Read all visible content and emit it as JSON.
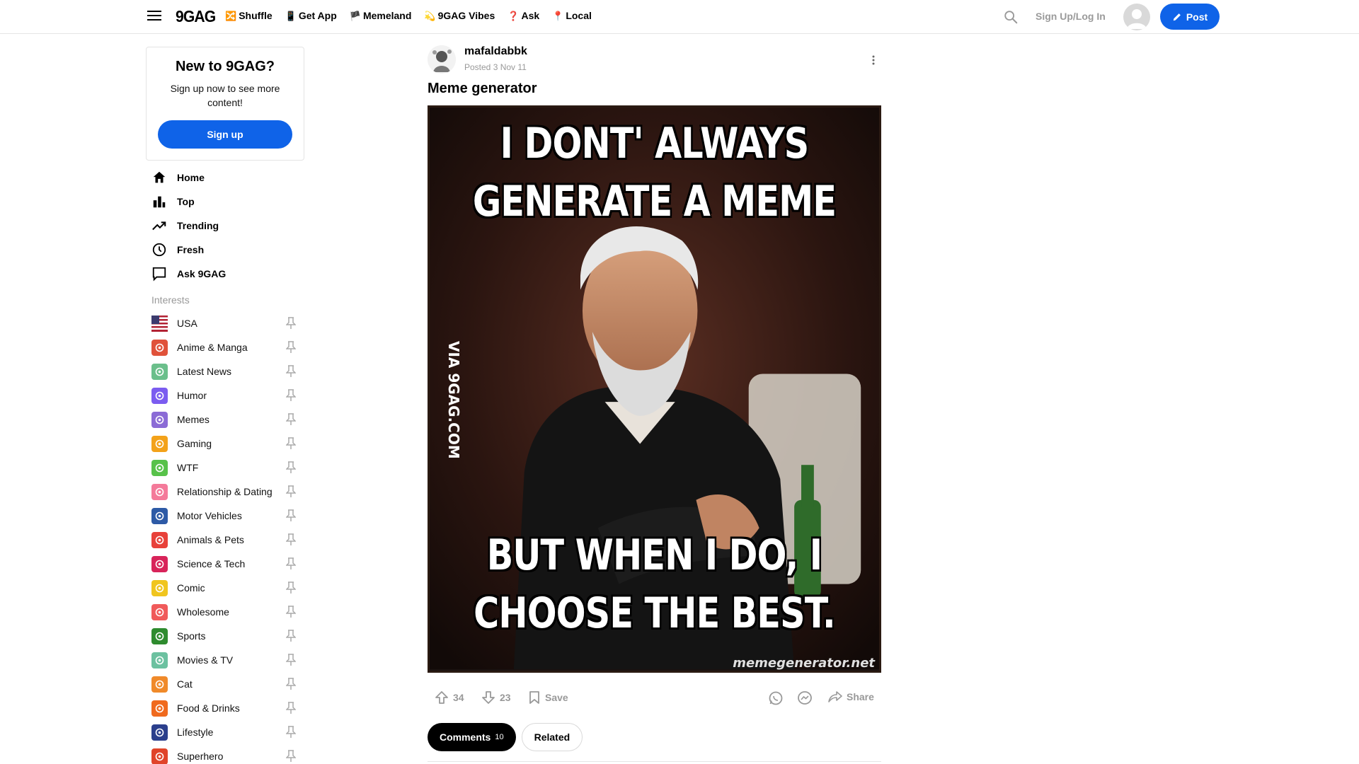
{
  "header": {
    "logo": "9GAG",
    "nav": [
      {
        "emoji": "🔀",
        "label": "Shuffle"
      },
      {
        "emoji": "📱",
        "label": "Get App"
      },
      {
        "emoji": "🏴",
        "label": "Memeland"
      },
      {
        "emoji": "💫",
        "label": "9GAG Vibes"
      },
      {
        "emoji": "❓",
        "label": "Ask"
      },
      {
        "emoji": "📍",
        "label": "Local"
      }
    ],
    "signup_login": "Sign Up/Log In",
    "post_label": "Post",
    "accent": "#0f63e8"
  },
  "sidebar": {
    "card": {
      "title": "New to 9GAG?",
      "text": "Sign up now to see more content!",
      "button": "Sign up"
    },
    "nav": [
      {
        "label": "Home",
        "icon": "home-icon"
      },
      {
        "label": "Top",
        "icon": "bar-chart-icon"
      },
      {
        "label": "Trending",
        "icon": "trending-icon"
      },
      {
        "label": "Fresh",
        "icon": "clock-icon"
      },
      {
        "label": "Ask 9GAG",
        "icon": "chat-icon"
      }
    ],
    "interests_title": "Interests",
    "interests": [
      {
        "label": "USA",
        "color": "#b22234"
      },
      {
        "label": "Anime & Manga",
        "color": "#e0523a"
      },
      {
        "label": "Latest News",
        "color": "#6bbf8b"
      },
      {
        "label": "Humor",
        "color": "#7b5cf0"
      },
      {
        "label": "Memes",
        "color": "#8b6bd6"
      },
      {
        "label": "Gaming",
        "color": "#f3a21a"
      },
      {
        "label": "WTF",
        "color": "#58c24a"
      },
      {
        "label": "Relationship & Dating",
        "color": "#f47a9a"
      },
      {
        "label": "Motor Vehicles",
        "color": "#2d5aa6"
      },
      {
        "label": "Animals & Pets",
        "color": "#e8413a"
      },
      {
        "label": "Science & Tech",
        "color": "#d8245a"
      },
      {
        "label": "Comic",
        "color": "#f0c51e"
      },
      {
        "label": "Wholesome",
        "color": "#f05a5a"
      },
      {
        "label": "Sports",
        "color": "#2e8b2e"
      },
      {
        "label": "Movies & TV",
        "color": "#6cc1a0"
      },
      {
        "label": "Cat",
        "color": "#f08a2a"
      },
      {
        "label": "Food & Drinks",
        "color": "#f06a1e"
      },
      {
        "label": "Lifestyle",
        "color": "#2b3f8c"
      },
      {
        "label": "Superhero",
        "color": "#e0442a"
      }
    ]
  },
  "post": {
    "author": "mafaldabbk",
    "posted": "Posted 3 Nov 11",
    "title": "Meme generator",
    "meme_top": "I DONT' ALWAYS GENERATE A MEME",
    "meme_bottom": "BUT WHEN I DO, I CHOOSE THE BEST.",
    "watermark_side": "VIA 9GAG.COM",
    "watermark_bottom": "memegenerator.net",
    "upvotes": "34",
    "downvotes": "23",
    "save_label": "Save",
    "share_label": "Share",
    "tabs": {
      "comments_label": "Comments",
      "comments_count": "10",
      "related_label": "Related"
    }
  }
}
